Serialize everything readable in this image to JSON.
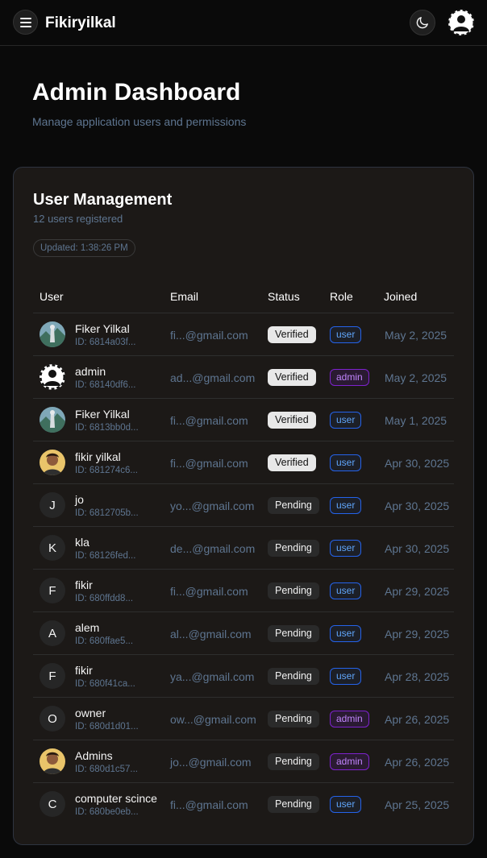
{
  "header": {
    "brand": "Fikiryilkal",
    "menu_icon": "menu-icon",
    "theme_icon": "moon-icon",
    "avatar_icon": "user-avatar-icon"
  },
  "page": {
    "title": "Admin Dashboard",
    "subtitle": "Manage application users and permissions"
  },
  "card": {
    "title": "User Management",
    "subtitle": "12 users registered",
    "updated": "Updated: 1:38:26 PM"
  },
  "table": {
    "columns": [
      "User",
      "Email",
      "Status",
      "Role",
      "Joined"
    ],
    "rows": [
      {
        "name": "Fiker Yilkal",
        "id": "ID: 6814a03f...",
        "email": "fi...@gmail.com",
        "status": "Verified",
        "role": "user",
        "joined": "May 2, 2025",
        "avatar": "landscape-photo",
        "initial": ""
      },
      {
        "name": "admin",
        "id": "ID: 68140df6...",
        "email": "ad...@gmail.com",
        "status": "Verified",
        "role": "admin",
        "joined": "May 2, 2025",
        "avatar": "profile-icon",
        "initial": ""
      },
      {
        "name": "Fiker Yilkal",
        "id": "ID: 6813bb0d...",
        "email": "fi...@gmail.com",
        "status": "Verified",
        "role": "user",
        "joined": "May 1, 2025",
        "avatar": "landscape-photo",
        "initial": ""
      },
      {
        "name": "fikir yilkal",
        "id": "ID: 681274c6...",
        "email": "fi...@gmail.com",
        "status": "Verified",
        "role": "user",
        "joined": "Apr 30, 2025",
        "avatar": "person-photo",
        "initial": ""
      },
      {
        "name": "jo",
        "id": "ID: 6812705b...",
        "email": "yo...@gmail.com",
        "status": "Pending",
        "role": "user",
        "joined": "Apr 30, 2025",
        "avatar": "initial",
        "initial": "J"
      },
      {
        "name": "kla",
        "id": "ID: 68126fed...",
        "email": "de...@gmail.com",
        "status": "Pending",
        "role": "user",
        "joined": "Apr 30, 2025",
        "avatar": "initial",
        "initial": "K"
      },
      {
        "name": "fikir",
        "id": "ID: 680ffdd8...",
        "email": "fi...@gmail.com",
        "status": "Pending",
        "role": "user",
        "joined": "Apr 29, 2025",
        "avatar": "initial",
        "initial": "F"
      },
      {
        "name": "alem",
        "id": "ID: 680ffae5...",
        "email": "al...@gmail.com",
        "status": "Pending",
        "role": "user",
        "joined": "Apr 29, 2025",
        "avatar": "initial",
        "initial": "A"
      },
      {
        "name": "fikir",
        "id": "ID: 680f41ca...",
        "email": "ya...@gmail.com",
        "status": "Pending",
        "role": "user",
        "joined": "Apr 28, 2025",
        "avatar": "initial",
        "initial": "F"
      },
      {
        "name": "owner",
        "id": "ID: 680d1d01...",
        "email": "ow...@gmail.com",
        "status": "Pending",
        "role": "admin",
        "joined": "Apr 26, 2025",
        "avatar": "initial",
        "initial": "O"
      },
      {
        "name": "Admins",
        "id": "ID: 680d1c57...",
        "email": "jo...@gmail.com",
        "status": "Pending",
        "role": "admin",
        "joined": "Apr 26, 2025",
        "avatar": "person-photo",
        "initial": ""
      },
      {
        "name": "computer scince",
        "id": "ID: 680be0eb...",
        "email": "fi...@gmail.com",
        "status": "Pending",
        "role": "user",
        "joined": "Apr 25, 2025",
        "avatar": "initial",
        "initial": "C"
      }
    ]
  },
  "colors": {
    "background": "#0a0a0a",
    "card": "#1c1917",
    "muted_text": "#5e7590",
    "role_user": "#60a5fa",
    "role_admin": "#c084fc"
  }
}
